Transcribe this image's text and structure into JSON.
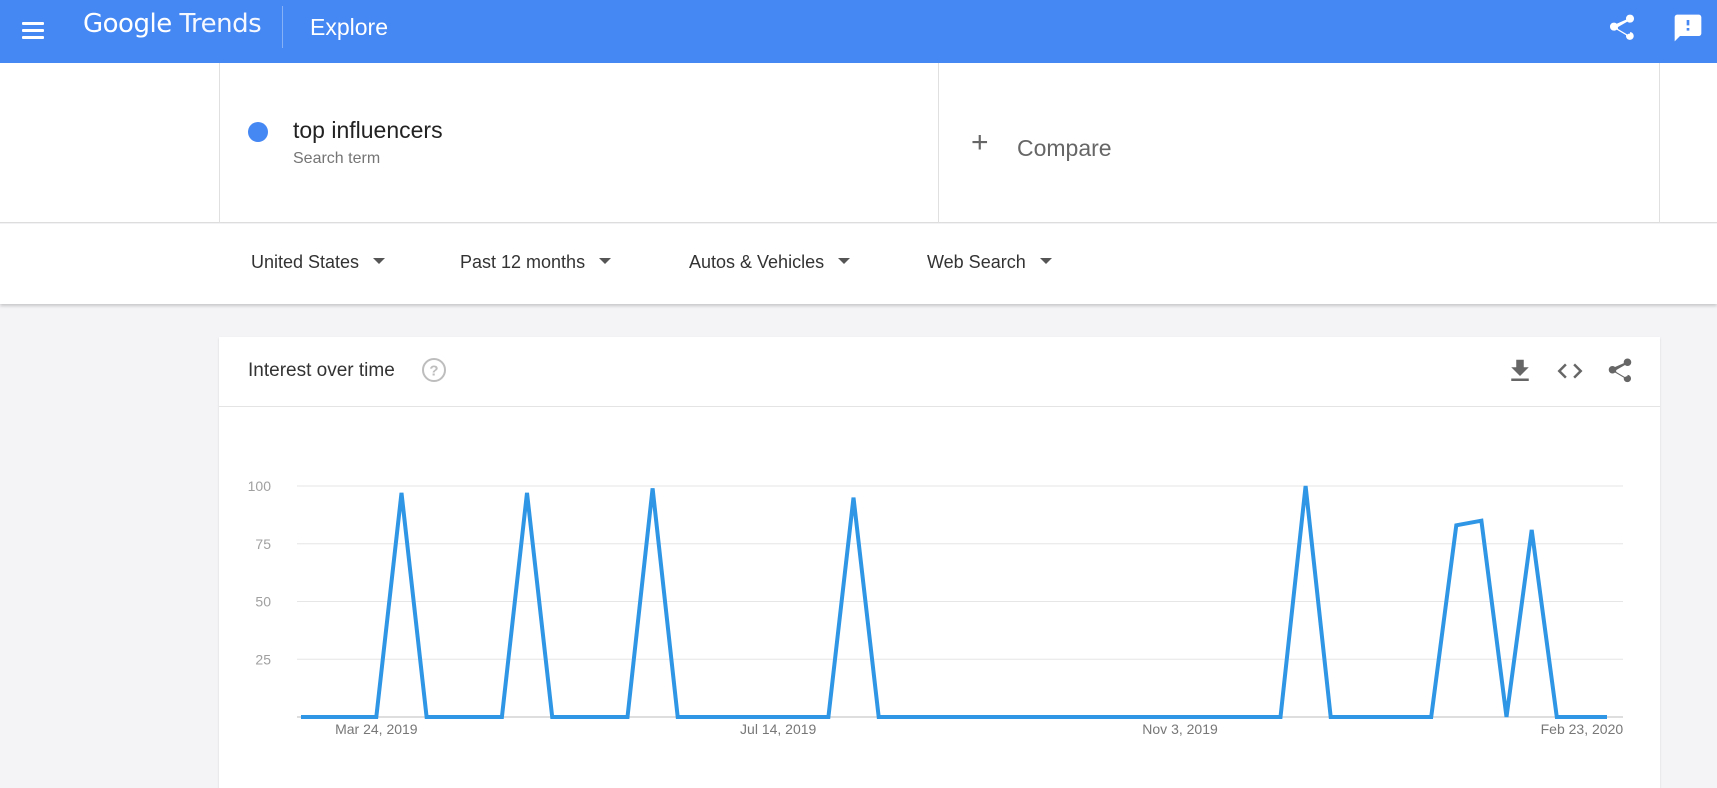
{
  "app": {
    "logo_google": "Google",
    "logo_trends": "Trends",
    "page_title": "Explore",
    "icons": [
      "menu-icon",
      "share-icon",
      "feedback-icon"
    ]
  },
  "search": {
    "term": "top influencers",
    "term_type": "Search term",
    "term_color": "#4587f3",
    "compare_label": "Compare"
  },
  "filters": {
    "region": "United States",
    "time_range": "Past 12 months",
    "category": "Autos & Vehicles",
    "search_type": "Web Search"
  },
  "interest_card": {
    "title": "Interest over time",
    "actions": [
      "download-icon",
      "embed-icon",
      "share-icon"
    ]
  },
  "chart_data": {
    "type": "line",
    "title": "",
    "xlabel": "",
    "ylabel": "",
    "ylim": [
      0,
      100
    ],
    "yticks": [
      25,
      50,
      75,
      100
    ],
    "grid": true,
    "color": "#2f96e6",
    "x_tick_labels": [
      "Mar 24, 2019",
      "Jul 14, 2019",
      "Nov 3, 2019",
      "Feb 23, 2020"
    ],
    "x": [
      "2019-03-03",
      "2019-03-10",
      "2019-03-17",
      "2019-03-24",
      "2019-03-31",
      "2019-04-07",
      "2019-04-14",
      "2019-04-21",
      "2019-04-28",
      "2019-05-05",
      "2019-05-12",
      "2019-05-19",
      "2019-05-26",
      "2019-06-02",
      "2019-06-09",
      "2019-06-16",
      "2019-06-23",
      "2019-06-30",
      "2019-07-07",
      "2019-07-14",
      "2019-07-21",
      "2019-07-28",
      "2019-08-04",
      "2019-08-11",
      "2019-08-18",
      "2019-08-25",
      "2019-09-01",
      "2019-09-08",
      "2019-09-15",
      "2019-09-22",
      "2019-09-29",
      "2019-10-06",
      "2019-10-13",
      "2019-10-20",
      "2019-10-27",
      "2019-11-03",
      "2019-11-10",
      "2019-11-17",
      "2019-11-24",
      "2019-12-01",
      "2019-12-08",
      "2019-12-15",
      "2019-12-22",
      "2019-12-29",
      "2020-01-05",
      "2020-01-12",
      "2020-01-19",
      "2020-01-26",
      "2020-02-02",
      "2020-02-09",
      "2020-02-16",
      "2020-02-23",
      "2020-03-01"
    ],
    "values": [
      0,
      0,
      0,
      0,
      97,
      0,
      0,
      0,
      0,
      97,
      0,
      0,
      0,
      0,
      99,
      0,
      0,
      0,
      0,
      0,
      0,
      0,
      95,
      0,
      0,
      0,
      0,
      0,
      0,
      0,
      0,
      0,
      0,
      0,
      0,
      0,
      0,
      0,
      0,
      0,
      100,
      0,
      0,
      0,
      0,
      0,
      83,
      85,
      0,
      81,
      0,
      0,
      0
    ]
  }
}
